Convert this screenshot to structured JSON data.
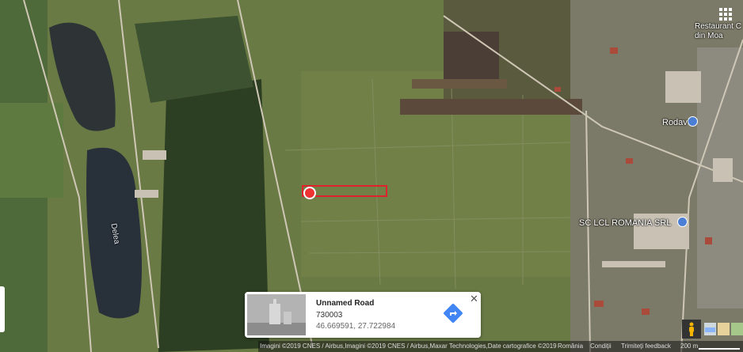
{
  "labels": {
    "restaurant_line1": "Restaurant C",
    "restaurant_line2": "din Moa",
    "rodav": "Rodav",
    "sclcl": "SC LCL ROMANIA SRL",
    "lake": "Delea"
  },
  "icons": {
    "apps": "apps-grid-icon",
    "marker": "dropped-pin-icon",
    "directions": "directions-icon",
    "close": "close-icon",
    "pegman": "street-view-pegman-icon",
    "layers": "map-layers-icon"
  },
  "info_card": {
    "title": "Unnamed Road",
    "postal_code": "730003",
    "coordinates": "46.669591, 27.722984",
    "close_glyph": "✕"
  },
  "footer": {
    "attribution": "Imagini ©2019 CNES / Airbus,Imagini ©2019 CNES / Airbus,Maxar Technologies,Date cartografice ©2019",
    "country": "România",
    "terms": "Condiții",
    "feedback": "Trimiteți feedback",
    "scale": "200 m"
  },
  "colors": {
    "highlight": "#e0222a",
    "poi_pin": "#4b7fd6",
    "directions": "#4285f4"
  }
}
